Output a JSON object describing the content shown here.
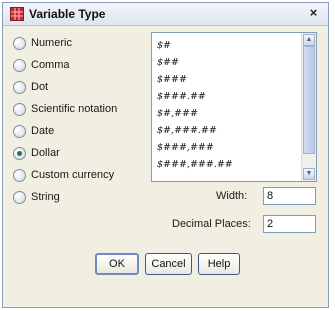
{
  "window": {
    "title": "Variable Type",
    "close_symbol": "×"
  },
  "types": [
    {
      "label": "Numeric",
      "selected": false
    },
    {
      "label": "Comma",
      "selected": false
    },
    {
      "label": "Dot",
      "selected": false
    },
    {
      "label": "Scientific notation",
      "selected": false
    },
    {
      "label": "Date",
      "selected": false
    },
    {
      "label": "Dollar",
      "selected": true
    },
    {
      "label": "Custom currency",
      "selected": false
    },
    {
      "label": "String",
      "selected": false
    }
  ],
  "formats": [
    "$#",
    "$##",
    "$###",
    "$###.##",
    "$#,###",
    "$#,###.##",
    "$###,###",
    "$###,###.##"
  ],
  "width": {
    "label": "Width:",
    "value": "8"
  },
  "decimals": {
    "label": "Decimal Places:",
    "value": "2"
  },
  "buttons": {
    "ok": "OK",
    "cancel": "Cancel",
    "help": "Help"
  },
  "scroll_up": "▲",
  "scroll_down": "▼"
}
